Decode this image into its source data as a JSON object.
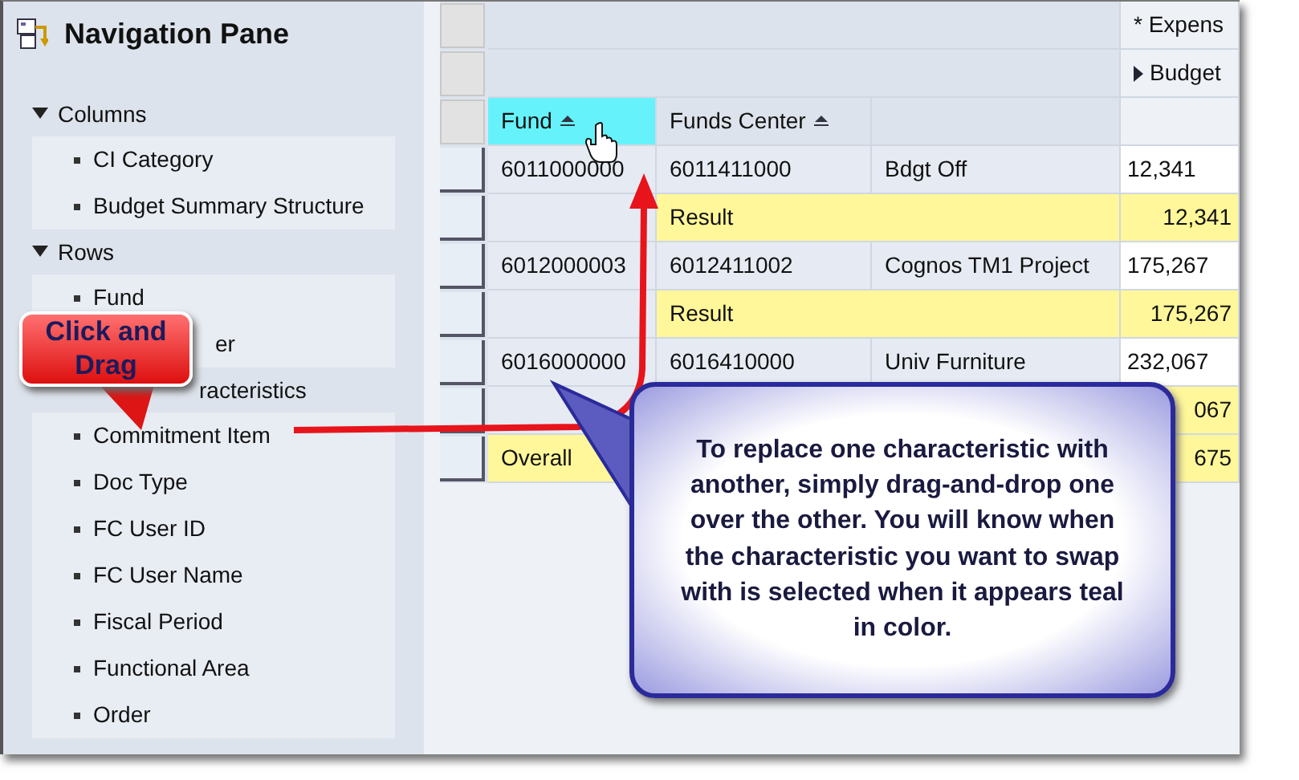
{
  "navigation_pane": {
    "title": "Navigation Pane",
    "sections": [
      {
        "kind": "full",
        "label": "Columns",
        "expanded": true,
        "items": [
          {
            "kind": "full",
            "label": "CI Category"
          },
          {
            "kind": "full",
            "label": "Budget Summary Structure"
          }
        ]
      },
      {
        "kind": "full",
        "label": "Rows",
        "expanded": true,
        "items": [
          {
            "kind": "full",
            "label": "Fund"
          },
          {
            "kind": "partial",
            "label": "er"
          }
        ]
      },
      {
        "kind": "partial",
        "label": "racteristics",
        "items": [
          {
            "kind": "full",
            "label": "Commitment Item"
          },
          {
            "kind": "full",
            "label": "Doc Type"
          },
          {
            "kind": "full",
            "label": "FC User ID"
          },
          {
            "kind": "full",
            "label": "FC User Name"
          },
          {
            "kind": "full",
            "label": "Fiscal Period"
          },
          {
            "kind": "full",
            "label": "Functional Area"
          },
          {
            "kind": "full",
            "label": "Order"
          }
        ]
      }
    ]
  },
  "table": {
    "header_rows": [
      {
        "text": "* Expens",
        "expander": false
      },
      {
        "text": "Budget",
        "expander": true
      }
    ],
    "columns": [
      {
        "label": "Fund",
        "selected": true
      },
      {
        "label": "Funds Center",
        "selected": false
      }
    ],
    "rows": [
      {
        "kind": "data",
        "cells": [
          "6011000000",
          "6011411000",
          "Bdgt Off",
          "12,341"
        ]
      },
      {
        "kind": "result",
        "label": "Result",
        "value": "12,341"
      },
      {
        "kind": "data",
        "cells": [
          "6012000003",
          "6012411002",
          "Cognos TM1 Project",
          "175,267"
        ]
      },
      {
        "kind": "result",
        "label": "Result",
        "value": "175,267"
      },
      {
        "kind": "data",
        "cells": [
          "6016000000",
          "6016410000",
          "Univ Furniture",
          "232,067"
        ]
      },
      {
        "kind": "result",
        "value": "067"
      },
      {
        "kind": "overall",
        "label": "Overall",
        "value": "675"
      }
    ]
  },
  "callouts": [
    {
      "kind": "red",
      "text": "Click and Drag"
    },
    {
      "kind": "blue",
      "text": "To replace one characteristic with another, simply drag-and-drop one over the other. You will know when the characteristic you want to swap with is selected when it appears teal in color."
    }
  ]
}
